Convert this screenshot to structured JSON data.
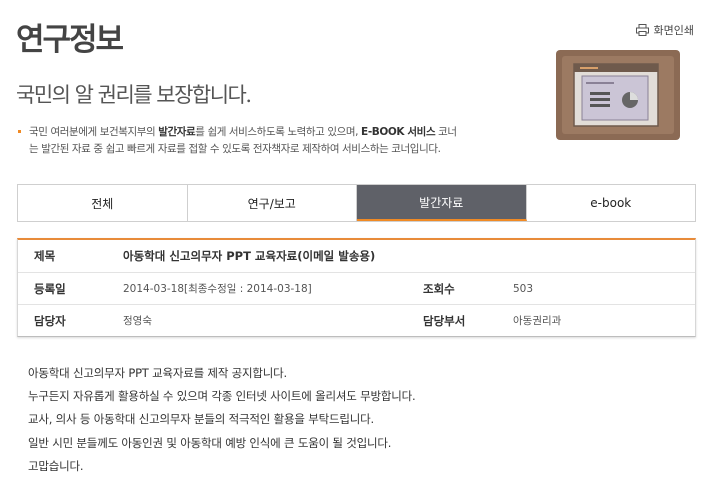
{
  "header": {
    "page_title": "연구정보",
    "print_label": "화면인쇄",
    "subtitle": "국민의 알 권리를 보장합니다."
  },
  "intro": {
    "part1": "국민 여러분에게 보건복지부의 ",
    "bold1": "발간자료",
    "part2": "를 쉽게 서비스하도록 노력하고 있으며, ",
    "bold2": "E-BOOK 서비스",
    "part3": " 코너",
    "line2": "는 발간된 자료 중 쉽고 빠르게 자료를 접할 수 있도록 전자책자로 제작하여 서비스하는 코너입니다."
  },
  "tabs": [
    {
      "label": "전체",
      "active": false
    },
    {
      "label": "연구/보고",
      "active": false
    },
    {
      "label": "발간자료",
      "active": true
    },
    {
      "label": "e-book",
      "active": false
    }
  ],
  "detail": {
    "title_label": "제목",
    "title_value": "아동학대 신고의무자 PPT 교육자료(이메일 발송용)",
    "date_label": "등록일",
    "date_value": "2014-03-18[최종수정일 : 2014-03-18]",
    "views_label": "조회수",
    "views_value": "503",
    "manager_label": "담당자",
    "manager_value": "정영숙",
    "dept_label": "담당부서",
    "dept_value": "아동권리과"
  },
  "content_lines": [
    "아동학대 신고의무자 PPT 교육자료를 제작 공지합니다.",
    "누구든지 자유롭게 활용하실 수 있으며 각종 인터넷 사이트에 올리셔도 무방합니다.",
    "교사, 의사 등 아동학대 신고의무자 분들의 적극적인 활용을 부탁드립니다.",
    "일반 시민 분들께도 아동인권 및 아동학대 예방 인식에 큰 도움이 될 것입니다.",
    "고맙습니다."
  ],
  "colors": {
    "accent": "#f08a24",
    "active_tab": "#5f6168",
    "illustration_bg": "#8a6b55"
  },
  "icons": {
    "print": "printer-icon",
    "illustration": "presentation-screen-illustration"
  }
}
